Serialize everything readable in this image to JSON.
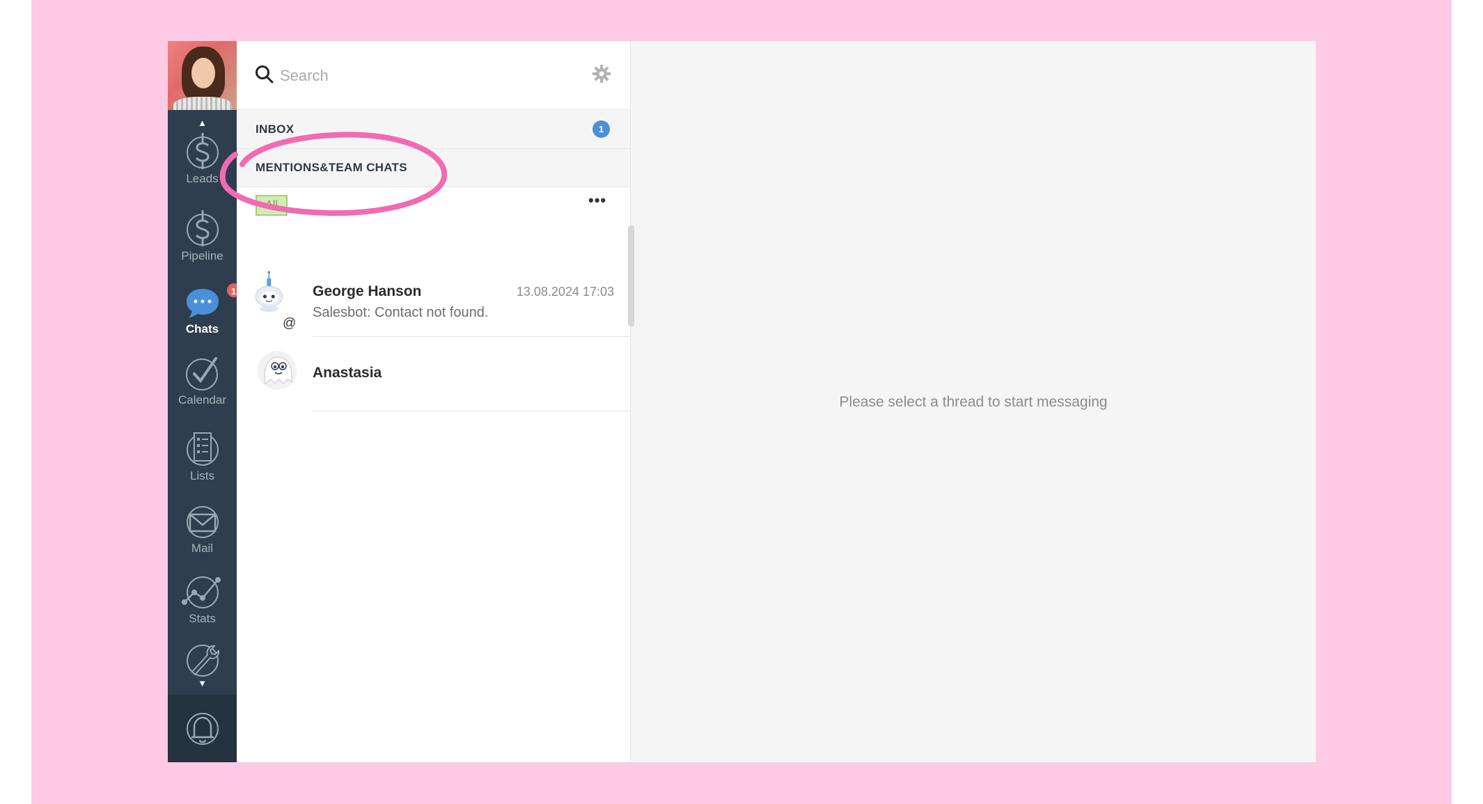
{
  "sidebar": {
    "items": [
      {
        "label": "Leads",
        "icon": "dollar-icon"
      },
      {
        "label": "Pipeline",
        "icon": "dollar-icon"
      },
      {
        "label": "Chats",
        "icon": "chat-bubble-icon",
        "active": true,
        "badge": "1"
      },
      {
        "label": "Calendar",
        "icon": "check-circle-icon"
      },
      {
        "label": "Lists",
        "icon": "list-icon"
      },
      {
        "label": "Mail",
        "icon": "mail-icon"
      },
      {
        "label": "Stats",
        "icon": "stats-icon"
      }
    ]
  },
  "search": {
    "placeholder": "Search"
  },
  "sections": {
    "inbox": {
      "title": "INBOX",
      "badge": "1"
    },
    "mentions": {
      "title": "MENTIONS&TEAM CHATS"
    }
  },
  "filter": {
    "label": "All",
    "more": "•••"
  },
  "chats": [
    {
      "name": "George Hanson",
      "time": "13.08.2024 17:03",
      "message": "Salesbot: Contact not found.",
      "mention": "@"
    },
    {
      "name": "Anastasia",
      "time": "",
      "message": ""
    }
  ],
  "empty_state": {
    "text": "Please select a thread to start messaging"
  },
  "colors": {
    "background": "#ffcae3",
    "sidebar": "#2f3e4e",
    "badge_red": "#e0635e",
    "badge_blue": "#4a90d9",
    "filter_bg": "#d3ebb4",
    "highlight": "#f06bb1"
  }
}
